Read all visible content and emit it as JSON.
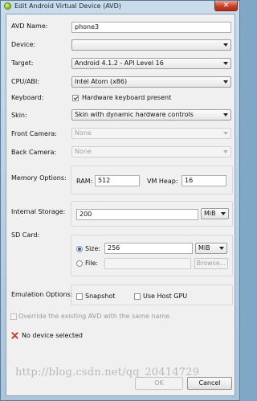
{
  "window": {
    "title": "Edit Android Virtual Device (AVD)",
    "close_glyph": "✕"
  },
  "labels": {
    "avd_name": "AVD Name:",
    "device": "Device:",
    "target": "Target:",
    "cpu_abi": "CPU/ABI:",
    "keyboard": "Keyboard:",
    "skin": "Skin:",
    "front_camera": "Front Camera:",
    "back_camera": "Back Camera:",
    "memory_options": "Memory Options:",
    "ram": "RAM:",
    "vm_heap": "VM Heap:",
    "internal_storage": "Internal Storage:",
    "sd_card": "SD Card:",
    "size": "Size:",
    "file": "File:",
    "emulation_options": "Emulation Options:"
  },
  "values": {
    "avd_name": "phone3",
    "device": "",
    "target": "Android 4.1.2 - API Level 16",
    "cpu_abi": "Intel Atom (x86)",
    "keyboard_label": "Hardware keyboard present",
    "skin": "Skin with dynamic hardware controls",
    "front_camera": "None",
    "back_camera": "None",
    "ram": "512",
    "vm_heap": "16",
    "internal_storage": "200",
    "internal_storage_unit": "MiB",
    "sd_size": "256",
    "sd_size_unit": "MiB",
    "sd_file": ""
  },
  "state": {
    "keyboard_checked": true,
    "sd_size_selected": true,
    "snapshot_checked": false,
    "host_gpu_checked": false,
    "override_checked": false
  },
  "buttons": {
    "browse": "Browse...",
    "ok": "OK",
    "cancel": "Cancel"
  },
  "emulation": {
    "snapshot": "Snapshot",
    "host_gpu": "Use Host GPU"
  },
  "override_label": "Override the existing AVD with the same name",
  "status": {
    "message": "No device selected",
    "icon": "error-x-icon",
    "color": "#d33a2c"
  },
  "watermark": "http://blog.csdn.net/qq_20414729"
}
